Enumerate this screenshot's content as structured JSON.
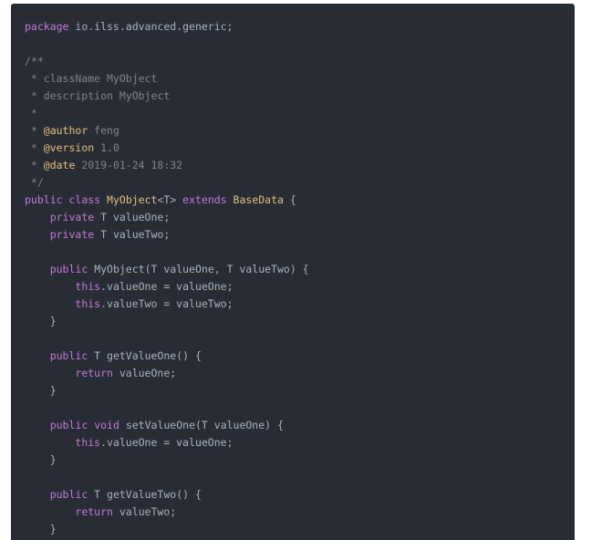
{
  "code_block": {
    "language": "java",
    "theme": {
      "background": "#282c34",
      "plain": "#abb2bf",
      "keyword": "#c678dd",
      "class": "#e5c07b",
      "function": "#61afef",
      "comment": "#7f848e",
      "number": "#d19a66"
    },
    "lines": [
      [
        {
          "t": "package",
          "k": "keyword"
        },
        {
          "t": " io.ilss.advanced.generic;",
          "k": "plain"
        }
      ],
      [],
      [
        {
          "t": "/**",
          "k": "comment"
        }
      ],
      [
        {
          "t": " * className MyObject",
          "k": "comment"
        }
      ],
      [
        {
          "t": " * description MyObject",
          "k": "comment"
        }
      ],
      [
        {
          "t": " *",
          "k": "comment"
        }
      ],
      [
        {
          "t": " * ",
          "k": "comment"
        },
        {
          "t": "@author",
          "k": "annot"
        },
        {
          "t": " feng",
          "k": "comment"
        }
      ],
      [
        {
          "t": " * ",
          "k": "comment"
        },
        {
          "t": "@version",
          "k": "annot"
        },
        {
          "t": " 1.0",
          "k": "comment"
        }
      ],
      [
        {
          "t": " * ",
          "k": "comment"
        },
        {
          "t": "@date",
          "k": "annot"
        },
        {
          "t": " 2019-01-24 18:32",
          "k": "comment"
        }
      ],
      [
        {
          "t": " */",
          "k": "comment"
        }
      ],
      [
        {
          "t": "public",
          "k": "keyword"
        },
        {
          "t": " ",
          "k": "plain"
        },
        {
          "t": "class",
          "k": "keyword"
        },
        {
          "t": " ",
          "k": "plain"
        },
        {
          "t": "MyObject",
          "k": "class"
        },
        {
          "t": "<T> ",
          "k": "plain"
        },
        {
          "t": "extends",
          "k": "keyword"
        },
        {
          "t": " ",
          "k": "plain"
        },
        {
          "t": "BaseData",
          "k": "class"
        },
        {
          "t": " {",
          "k": "plain"
        }
      ],
      [
        {
          "t": "    ",
          "k": "plain"
        },
        {
          "t": "private",
          "k": "keyword"
        },
        {
          "t": " T valueOne;",
          "k": "plain"
        }
      ],
      [
        {
          "t": "    ",
          "k": "plain"
        },
        {
          "t": "private",
          "k": "keyword"
        },
        {
          "t": " T valueTwo;",
          "k": "plain"
        }
      ],
      [],
      [
        {
          "t": "    ",
          "k": "plain"
        },
        {
          "t": "public",
          "k": "keyword"
        },
        {
          "t": " ",
          "k": "plain"
        },
        {
          "t": "MyObject",
          "k": "function"
        },
        {
          "t": "(T valueOne, T valueTwo) {",
          "k": "plain"
        }
      ],
      [
        {
          "t": "        ",
          "k": "plain"
        },
        {
          "t": "this",
          "k": "this"
        },
        {
          "t": ".valueOne = valueOne;",
          "k": "plain"
        }
      ],
      [
        {
          "t": "        ",
          "k": "plain"
        },
        {
          "t": "this",
          "k": "this"
        },
        {
          "t": ".valueTwo = valueTwo;",
          "k": "plain"
        }
      ],
      [
        {
          "t": "    }",
          "k": "plain"
        }
      ],
      [],
      [
        {
          "t": "    ",
          "k": "plain"
        },
        {
          "t": "public",
          "k": "keyword"
        },
        {
          "t": " T ",
          "k": "plain"
        },
        {
          "t": "getValueOne",
          "k": "function"
        },
        {
          "t": "() {",
          "k": "plain"
        }
      ],
      [
        {
          "t": "        ",
          "k": "plain"
        },
        {
          "t": "return",
          "k": "keyword"
        },
        {
          "t": " valueOne;",
          "k": "plain"
        }
      ],
      [
        {
          "t": "    }",
          "k": "plain"
        }
      ],
      [],
      [
        {
          "t": "    ",
          "k": "plain"
        },
        {
          "t": "public",
          "k": "keyword"
        },
        {
          "t": " ",
          "k": "plain"
        },
        {
          "t": "void",
          "k": "keyword"
        },
        {
          "t": " ",
          "k": "plain"
        },
        {
          "t": "setValueOne",
          "k": "function"
        },
        {
          "t": "(T valueOne) {",
          "k": "plain"
        }
      ],
      [
        {
          "t": "        ",
          "k": "plain"
        },
        {
          "t": "this",
          "k": "this"
        },
        {
          "t": ".valueOne = valueOne;",
          "k": "plain"
        }
      ],
      [
        {
          "t": "    }",
          "k": "plain"
        }
      ],
      [],
      [
        {
          "t": "    ",
          "k": "plain"
        },
        {
          "t": "public",
          "k": "keyword"
        },
        {
          "t": " T ",
          "k": "plain"
        },
        {
          "t": "getValueTwo",
          "k": "function"
        },
        {
          "t": "() {",
          "k": "plain"
        }
      ],
      [
        {
          "t": "        ",
          "k": "plain"
        },
        {
          "t": "return",
          "k": "keyword"
        },
        {
          "t": " valueTwo;",
          "k": "plain"
        }
      ],
      [
        {
          "t": "    }",
          "k": "plain"
        }
      ]
    ]
  }
}
